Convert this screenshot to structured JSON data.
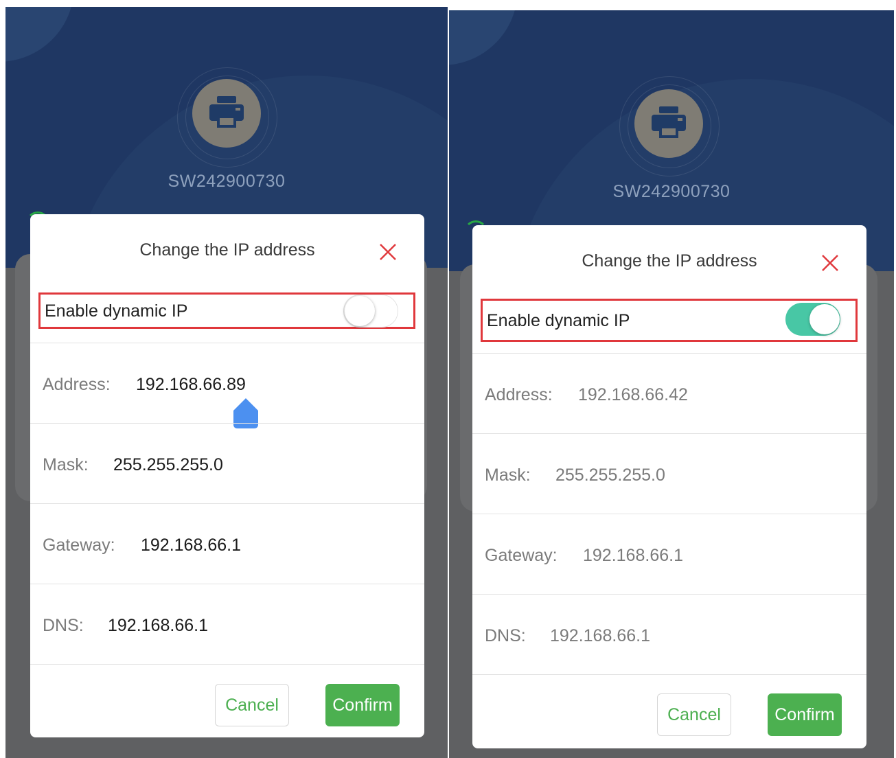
{
  "colors": {
    "hero_bg": "#1f3763",
    "overlay": "#5f6062",
    "accent_green": "#4cb050",
    "toggle_on": "#48c7a5",
    "highlight_red": "#e0383c",
    "close_red": "#e0383c"
  },
  "left": {
    "device_name": "SW242900730",
    "dialog": {
      "title": "Change the IP address",
      "close_icon": "close-icon",
      "dynamic_label": "Enable dynamic IP",
      "dynamic_enabled": false,
      "address_label": "Address:",
      "address_value": "192.168.66.89",
      "mask_label": "Mask:",
      "mask_value": "255.255.255.0",
      "gateway_label": "Gateway:",
      "gateway_value": "192.168.66.1",
      "dns_label": "DNS:",
      "dns_value": "192.168.66.1",
      "cancel": "Cancel",
      "confirm": "Confirm"
    }
  },
  "right": {
    "device_name": "SW242900730",
    "dialog": {
      "title": "Change the IP address",
      "close_icon": "close-icon",
      "dynamic_label": "Enable dynamic IP",
      "dynamic_enabled": true,
      "address_label": "Address:",
      "address_value": "192.168.66.42",
      "mask_label": "Mask:",
      "mask_value": "255.255.255.0",
      "gateway_label": "Gateway:",
      "gateway_value": "192.168.66.1",
      "dns_label": "DNS:",
      "dns_value": "192.168.66.1",
      "cancel": "Cancel",
      "confirm": "Confirm"
    }
  }
}
